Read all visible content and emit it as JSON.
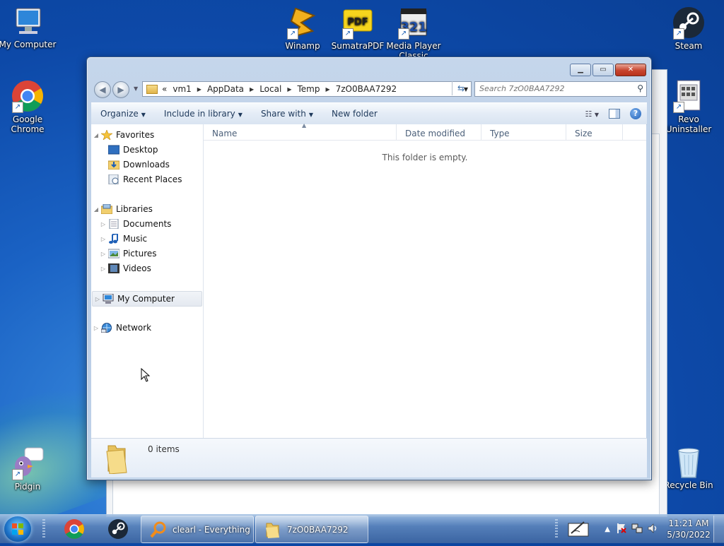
{
  "desktop": {
    "icons": [
      {
        "name": "my-computer-desktop-icon",
        "label": "My Computer"
      },
      {
        "name": "google-chrome-desktop-icon",
        "label": "Google\nChrome"
      },
      {
        "name": "pidgin-desktop-icon",
        "label": "Pidgin"
      },
      {
        "name": "winamp-desktop-icon",
        "label": "Winamp"
      },
      {
        "name": "sumatrapdf-desktop-icon",
        "label": "SumatraPDF"
      },
      {
        "name": "media-player-classic-desktop-icon",
        "label": "Media Player Classic"
      },
      {
        "name": "steam-desktop-icon",
        "label": "Steam"
      },
      {
        "name": "revo-uninstaller-desktop-icon",
        "label": "Revo Uninstaller"
      },
      {
        "name": "recycle-bin-desktop-icon",
        "label": "Recycle Bin"
      }
    ]
  },
  "explorer": {
    "breadcrumb": [
      "«",
      "vm1",
      "AppData",
      "Local",
      "Temp",
      "7zO0BAA7292"
    ],
    "search_placeholder": "Search 7zO0BAA7292",
    "toolbar": {
      "organize": "Organize",
      "include_in_library": "Include in library",
      "share_with": "Share with",
      "new_folder": "New folder"
    },
    "nav": {
      "favorites": "Favorites",
      "desktop": "Desktop",
      "downloads": "Downloads",
      "recent_places": "Recent Places",
      "libraries": "Libraries",
      "documents": "Documents",
      "music": "Music",
      "pictures": "Pictures",
      "videos": "Videos",
      "my_computer": "My Computer",
      "network": "Network"
    },
    "columns": [
      "Name",
      "Date modified",
      "Type",
      "Size"
    ],
    "empty_message": "This folder is empty.",
    "details_count": "0 items"
  },
  "taskbar": {
    "tasks": [
      {
        "label": "clearl - Everything"
      },
      {
        "label": "7zO0BAA7292"
      }
    ],
    "clock_time": "11:21 AM",
    "clock_date": "5/30/2022"
  },
  "colors": {
    "accent": "#1a62c4",
    "toolbar_text": "#1e395b",
    "close_button": "#c7452f"
  }
}
